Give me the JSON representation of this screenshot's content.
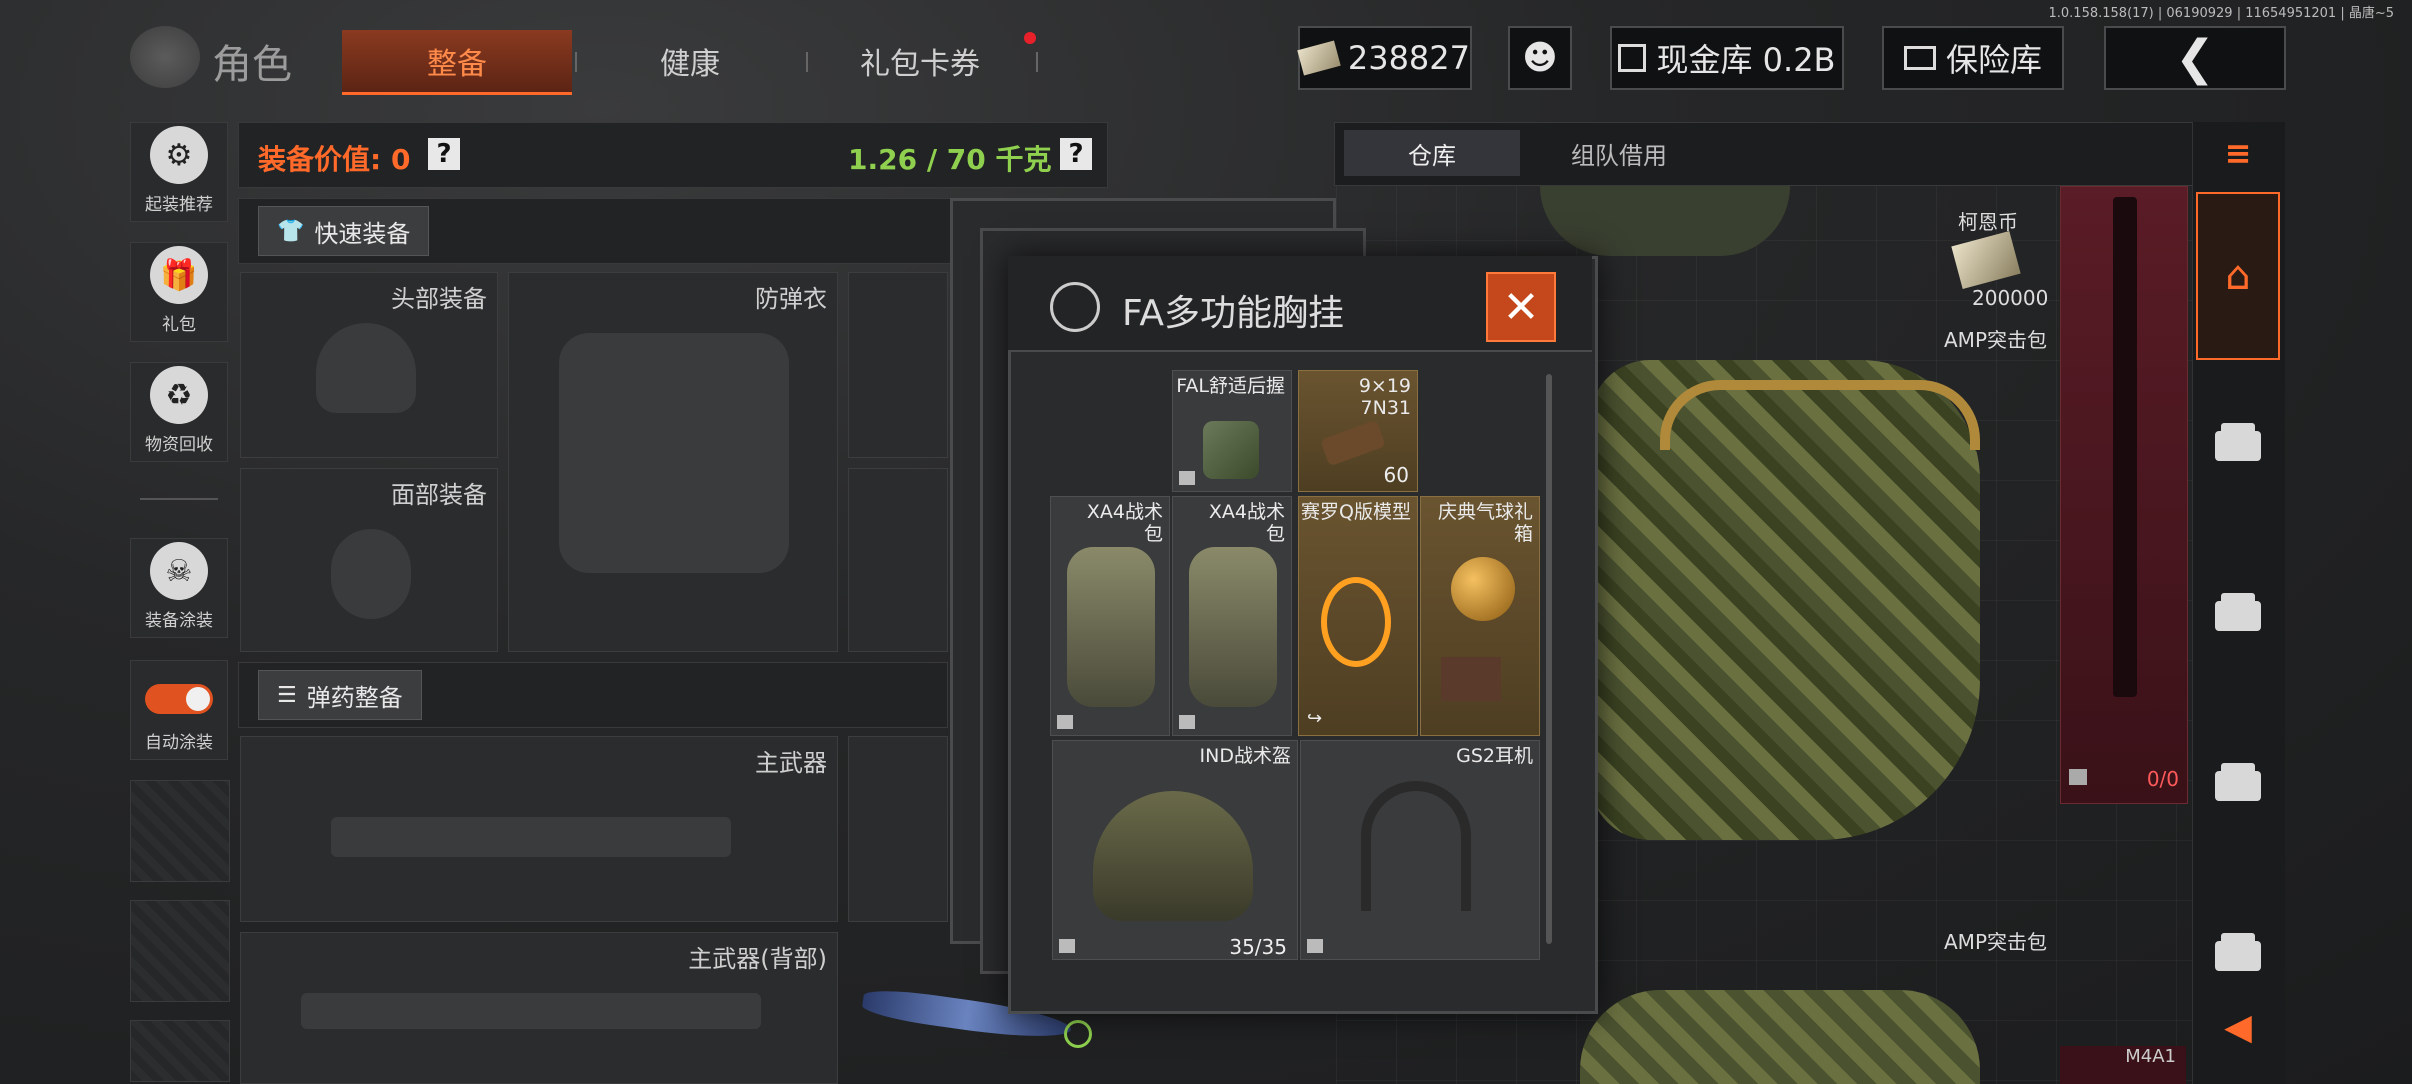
{
  "version_text": "1.0.158.158(17) | 06190929 | 11654951201 | 晶唐~5",
  "header": {
    "title": "角色",
    "tabs": [
      {
        "label": "整备",
        "active": true
      },
      {
        "label": "健康",
        "active": false
      },
      {
        "label": "礼包卡券",
        "active": false,
        "has_badge": true
      }
    ],
    "currency": "238827",
    "cash_vault": "现金库 0.2B",
    "safe_box": "保险库"
  },
  "sidebar": {
    "items": [
      {
        "label": "起装推荐",
        "icon": "helmet-gear-icon"
      },
      {
        "label": "礼包",
        "icon": "gift-icon"
      },
      {
        "label": "物资回收",
        "icon": "recycle-icon"
      },
      {
        "label": "装备涂装",
        "icon": "paint-icon"
      },
      {
        "label": "自动涂装",
        "icon": "toggle-icon"
      }
    ]
  },
  "loadout": {
    "value_label": "装备价值: 0",
    "weight": "1.26 / 70 千克",
    "quick_equip": "快速装备",
    "ammo_equip": "弹药整备",
    "slots": {
      "head": "头部装备",
      "armor": "防弹衣",
      "face": "面部装备",
      "primary": "主武器",
      "primary_back": "主武器(背部)"
    }
  },
  "popup": {
    "title": "FA多功能胸挂",
    "items": [
      {
        "name": "FAL舒适后握",
        "qty": ""
      },
      {
        "name": "9×19\n7N31",
        "qty": "60"
      },
      {
        "name": "XA4战术包",
        "qty": ""
      },
      {
        "name": "XA4战术包",
        "qty": ""
      },
      {
        "name": "赛罗Q版模型",
        "qty": ""
      },
      {
        "name": "庆典气球礼箱",
        "qty": ""
      },
      {
        "name": "IND战术盔",
        "qty": "35/35"
      },
      {
        "name": "GS2耳机",
        "qty": ""
      }
    ]
  },
  "storage": {
    "tabs": [
      "仓库",
      "组队借用"
    ],
    "koen_label": "柯恩币",
    "koen_count": "200000",
    "bag1": "AMP突击包",
    "bag2": "AMP突击包",
    "capacity": "0/0",
    "weapon_label": "M4A1"
  },
  "colors": {
    "accent": "#ff6a2a",
    "green": "#8fd14f"
  }
}
